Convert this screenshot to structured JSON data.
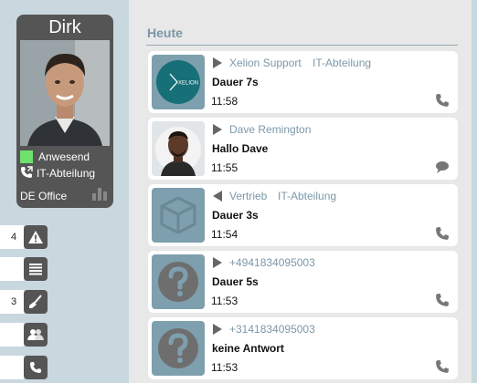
{
  "profile": {
    "name": "Dirk",
    "status_label": "Anwesend",
    "status_color": "#6ee06e",
    "department": "IT-Abteilung",
    "office": "DE Office"
  },
  "sidebar": [
    {
      "count": "4",
      "icon": "warning-icon"
    },
    {
      "count": "",
      "icon": "list-icon"
    },
    {
      "count": "3",
      "icon": "broom-icon"
    },
    {
      "count": "",
      "icon": "people-icon"
    },
    {
      "count": "",
      "icon": "phone-icon"
    }
  ],
  "section": {
    "heading": "Heute"
  },
  "calls": [
    {
      "direction": "outgoing",
      "name": "Xelion Support",
      "department": "IT-Abteilung",
      "title": "Dauer 7s",
      "time": "11:58",
      "type": "phone-icon",
      "avatar": "xelion-logo",
      "avatar_text": "XELION"
    },
    {
      "direction": "outgoing",
      "name": "Dave Remington",
      "department": "",
      "title": "Hallo Dave",
      "time": "11:55",
      "type": "chat-icon",
      "avatar": "person-photo"
    },
    {
      "direction": "incoming",
      "name": "Vertrieb",
      "department": "IT-Abteilung",
      "title": "Dauer 3s",
      "time": "11:54",
      "type": "phone-icon",
      "avatar": "box-icon"
    },
    {
      "direction": "outgoing",
      "name": "+4941834095003",
      "department": "",
      "title": "Dauer 5s",
      "time": "11:53",
      "type": "phone-icon",
      "avatar": "question-icon"
    },
    {
      "direction": "outgoing",
      "name": "+3141834095003",
      "department": "",
      "title": "keine Antwort",
      "time": "11:53",
      "type": "phone-icon",
      "avatar": "question-icon"
    }
  ]
}
